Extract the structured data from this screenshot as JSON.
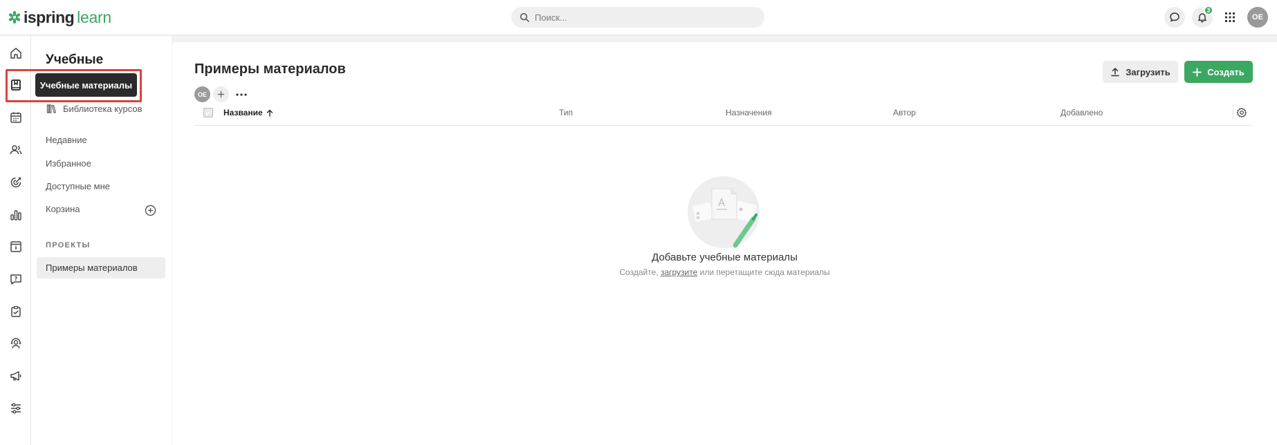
{
  "brand": {
    "name_part1": "ispring",
    "name_part2": "learn",
    "accent": "#3aa861"
  },
  "search": {
    "placeholder": "Поиск..."
  },
  "header": {
    "notifications_count": "3",
    "user_initials": "OE"
  },
  "sidebar": {
    "title": "Учебные",
    "tooltip": "Учебные материалы",
    "library": "Библиотека курсов",
    "links": [
      "Недавние",
      "Избранное",
      "Доступные мне",
      "Корзина"
    ],
    "projects_label": "ПРОЕКТЫ",
    "project_active": "Примеры материалов"
  },
  "main": {
    "title": "Примеры материалов",
    "member_initials": "OE",
    "upload_label": "Загрузить",
    "create_label": "Создать",
    "columns": [
      "Название",
      "Тип",
      "Назначения",
      "Автор",
      "Добавлено"
    ],
    "empty_title": "Добавьте учебные материалы",
    "empty_sub_prefix": "Создайте,",
    "empty_sub_link": "загрузите",
    "empty_sub_suffix": "или перетащите сюда материалы"
  }
}
